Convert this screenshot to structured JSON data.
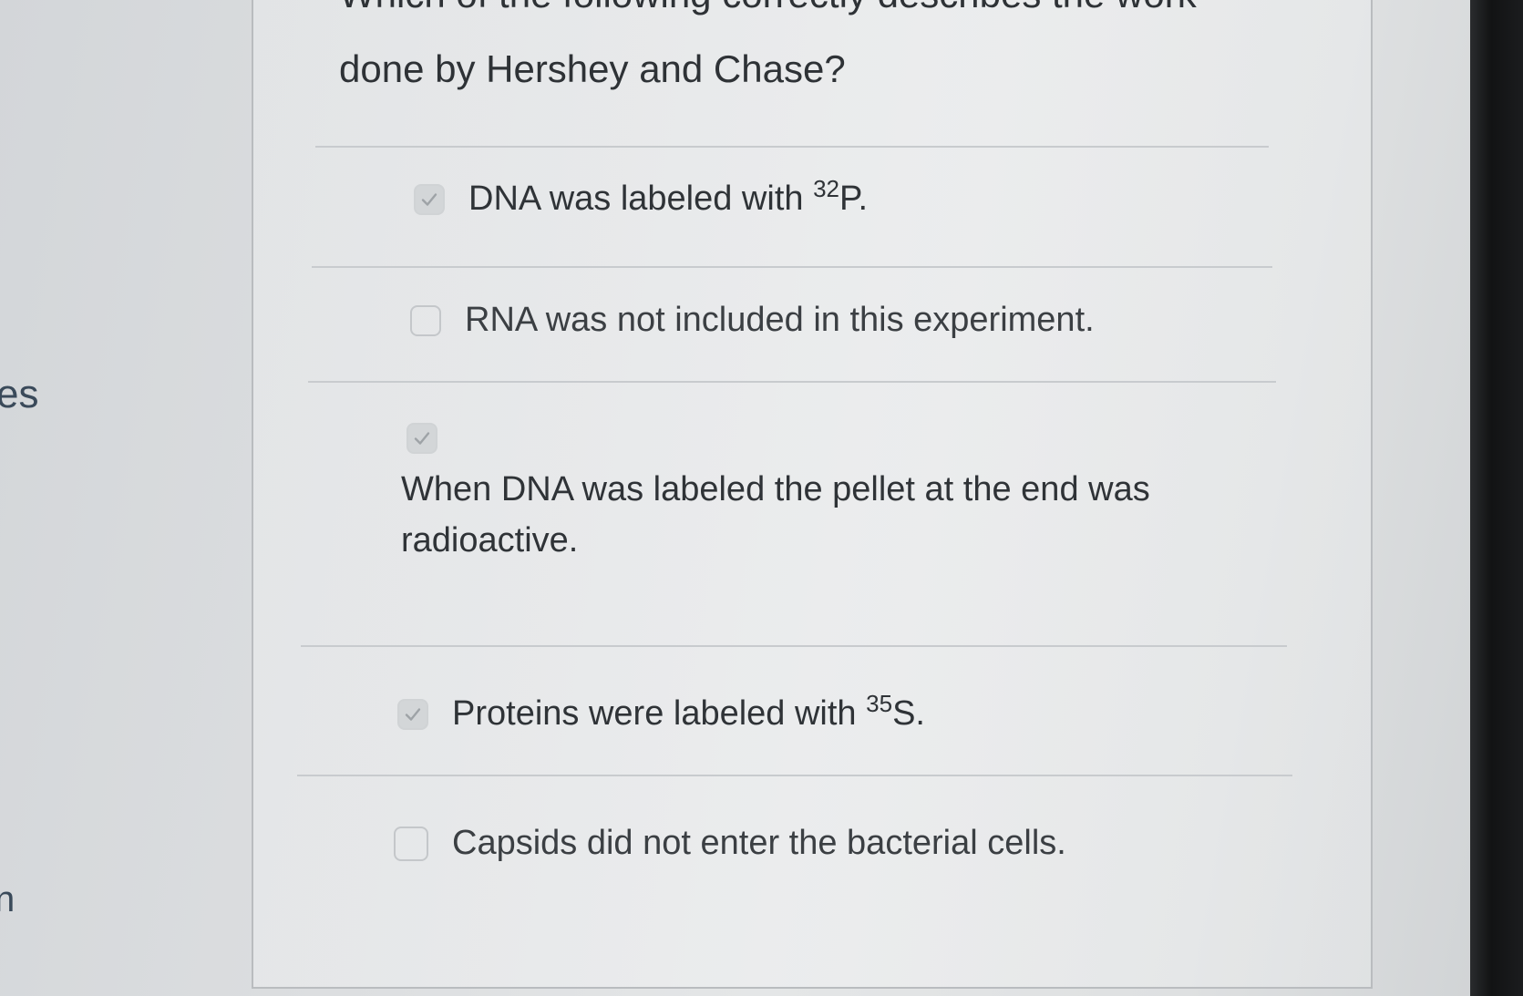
{
  "question": {
    "line1": "Which of the following correctly describes the work",
    "line2": "done by Hershey and Chase?"
  },
  "left_fragments": {
    "top": "es",
    "bottom": "n"
  },
  "options": [
    {
      "text_main": "DNA was labeled with ",
      "superscript": "32",
      "text_end": "P.",
      "checked": true,
      "icon": "checkmark-icon"
    },
    {
      "text_main": "RNA was not included in this experiment.",
      "checked": false,
      "icon": ""
    },
    {
      "text_main": "When DNA was labeled the pellet at the end was radioactive.",
      "checked": true,
      "icon": "checkmark-icon"
    },
    {
      "text_main": "Proteins were labeled with ",
      "superscript": "35",
      "text_end": "S.",
      "checked": true,
      "icon": "checkmark-icon"
    },
    {
      "text_main": "Capsids did not enter the bacterial cells.",
      "checked": false,
      "icon": ""
    }
  ],
  "colors": {
    "text": "#2f3337",
    "checkbox_fill": "#d3d6d8",
    "checkbox_border": "#c4c7ca",
    "divider": "#c8cbce"
  }
}
